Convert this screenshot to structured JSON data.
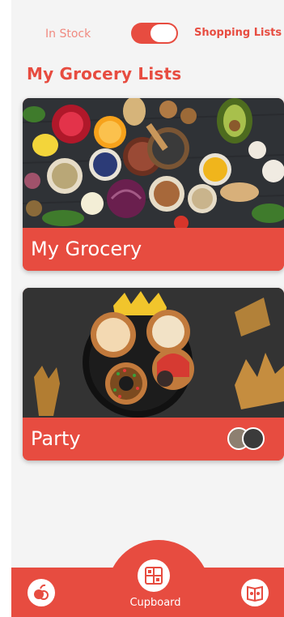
{
  "header": {
    "in_stock_label": "In Stock",
    "shopping_lists_label": "Shopping Lists",
    "toggle_state": "shopping-lists"
  },
  "page": {
    "title": "My Grocery Lists"
  },
  "lists": [
    {
      "title": "My Grocery",
      "image": "grocery-spread-photo"
    },
    {
      "title": "Party",
      "image": "cookies-platter-photo",
      "members_avatars": 2
    }
  ],
  "bottom_nav": {
    "center_label": "Cupboard",
    "left_icon": "pantry-fruit-icon",
    "center_icon": "cupboard-icon",
    "right_icon": "recipe-book-icon"
  },
  "colors": {
    "accent": "#e74c40",
    "background": "#f4f4f4",
    "muted_label": "#f08a80"
  }
}
